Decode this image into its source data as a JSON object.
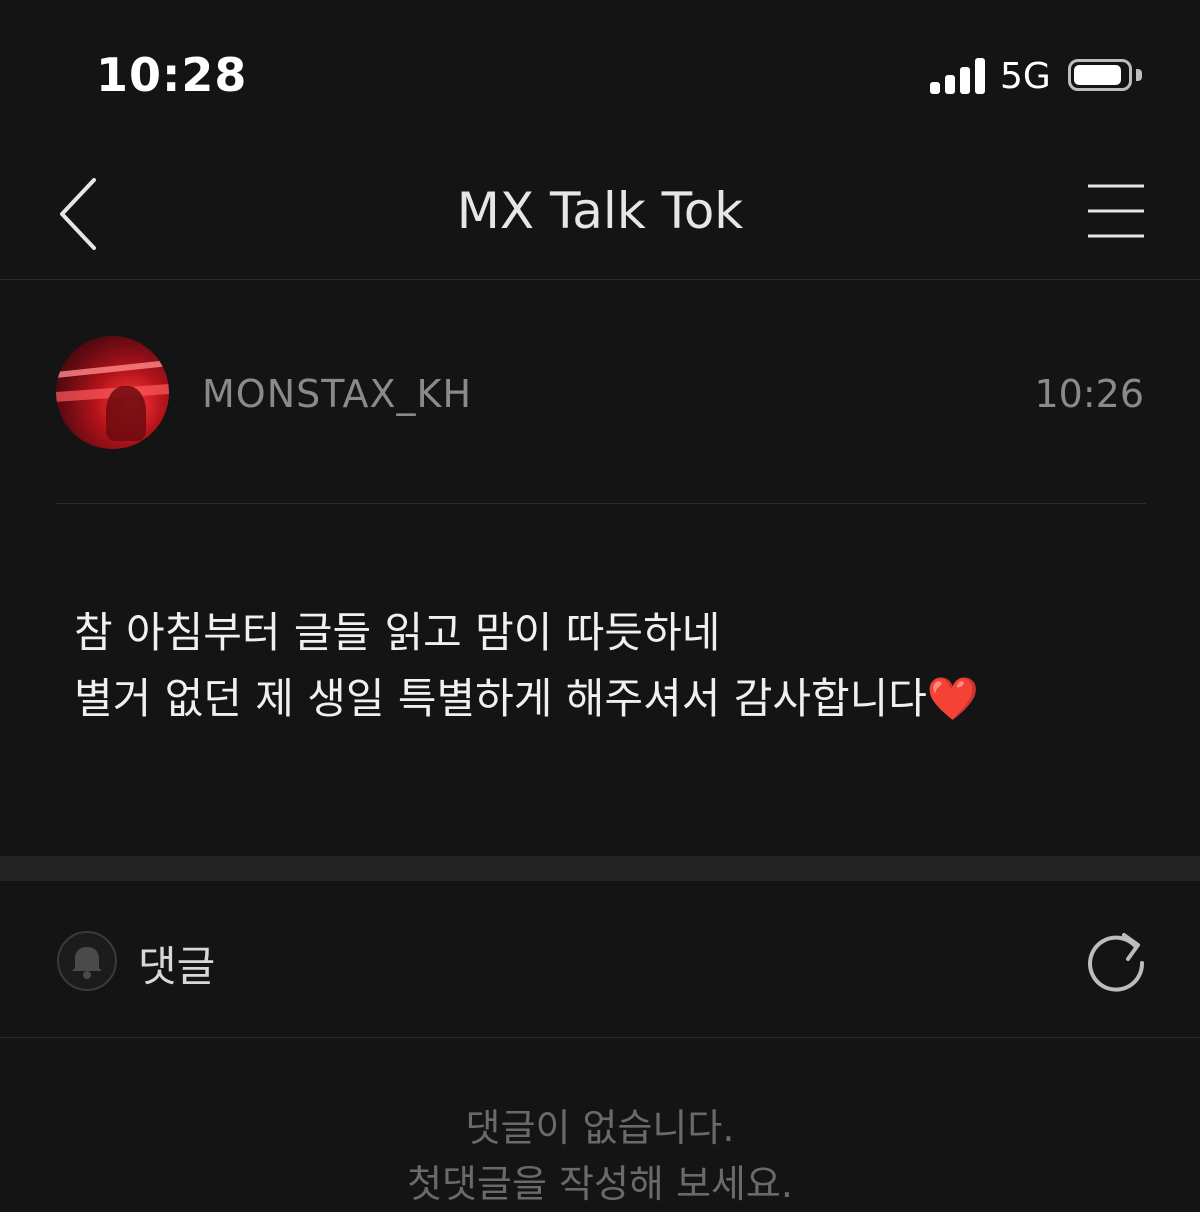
{
  "status_bar": {
    "time": "10:28",
    "network": "5G",
    "signal_bars": 4,
    "battery_level": 0.9
  },
  "nav": {
    "title": "MX Talk Tok",
    "back_icon": "chevron-left-icon",
    "menu_icon": "hamburger-menu-icon"
  },
  "post": {
    "author": "MONSTAX_KH",
    "time": "10:26",
    "body_lines": [
      "참 아침부터 글들 읽고 맘이 따듯하네",
      "별거 없던 제 생일 특별하게 해주셔서 감사합니다"
    ],
    "emoji": "❤️"
  },
  "comments": {
    "label": "댓글",
    "bell_icon": "bell-icon",
    "refresh_icon": "refresh-icon",
    "empty_line1": "댓글이 없습니다.",
    "empty_line2": "첫댓글을 작성해 보세요."
  },
  "colors": {
    "background": "#141414",
    "divider": "#2c2c2c",
    "muted_text": "#8a8a8a",
    "heart": "#e0202c"
  }
}
